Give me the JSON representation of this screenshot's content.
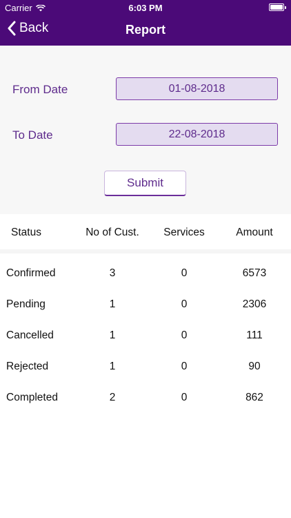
{
  "status_bar": {
    "carrier": "Carrier",
    "time": "6:03 PM"
  },
  "nav": {
    "back_label": "Back",
    "title": "Report"
  },
  "form": {
    "from_label": "From Date",
    "from_value": "01-08-2018",
    "to_label": "To Date",
    "to_value": "22-08-2018",
    "submit_label": "Submit"
  },
  "table": {
    "headers": [
      "Status",
      "No of Cust.",
      "Services",
      "Amount"
    ],
    "rows": [
      [
        "Confirmed",
        "3",
        "0",
        "6573"
      ],
      [
        "Pending",
        "1",
        "0",
        "2306"
      ],
      [
        "Cancelled",
        "1",
        "0",
        "111"
      ],
      [
        "Rejected",
        "1",
        "0",
        "90"
      ],
      [
        "Completed",
        "2",
        "0",
        "862"
      ]
    ]
  },
  "colors": {
    "header_bg": "#4b0a78",
    "accent": "#5e2b8c",
    "field_bg": "#e4dcf0"
  }
}
